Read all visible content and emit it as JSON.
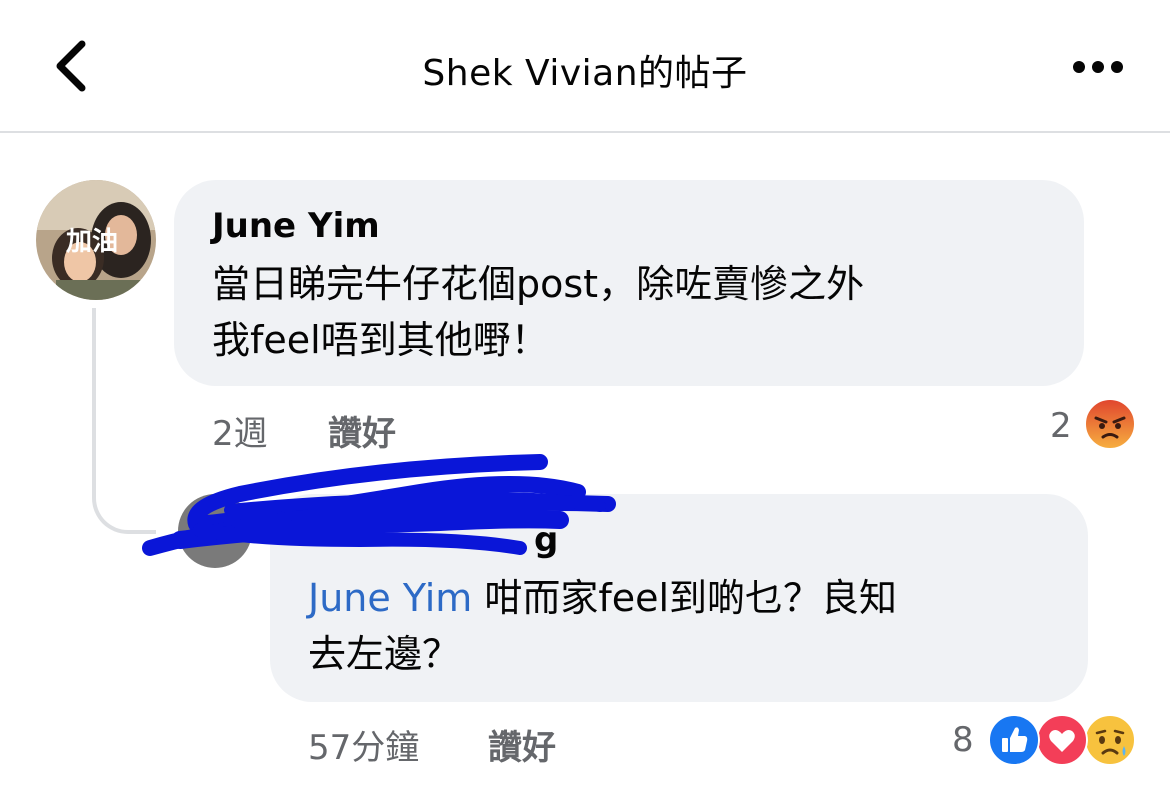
{
  "header": {
    "title": "Shek Vivian的帖子"
  },
  "comments": [
    {
      "author": "June Yim",
      "text_line1": "當日睇完牛仔花個post，除咗賣慘之外",
      "text_line2": "我feel唔到其他嘢！",
      "time": "2週",
      "like_label": "讚好",
      "reaction_count": "2"
    },
    {
      "author_partial": "g",
      "mention": "June Yim",
      "text_line1": " 咁而家feel到啲乜？良知",
      "text_line2": "去左邊？",
      "time": "57分鐘",
      "like_label": "讚好",
      "reaction_count": "8"
    }
  ],
  "colors": {
    "bubble": "#f0f2f5",
    "mention": "#2d6ac6",
    "meta": "#65676b",
    "like_reaction": "#1877f2",
    "love_reaction": "#f33e58",
    "emoji_yellow": "#f7c23e",
    "angry_top": "#e0442e",
    "scribble": "#0a16d8"
  },
  "icons": [
    "back-chevron-icon",
    "more-dots-icon",
    "angry-reaction-icon",
    "like-reaction-icon",
    "love-reaction-icon",
    "sad-reaction-icon"
  ]
}
